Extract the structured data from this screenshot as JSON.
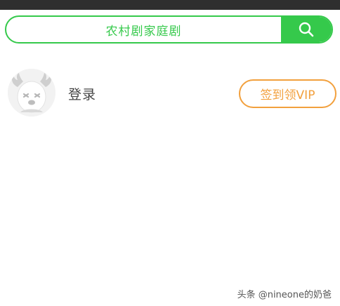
{
  "search": {
    "text": "农村剧家庭剧",
    "button_icon": "search-icon",
    "accent_color": "#35c94b"
  },
  "profile": {
    "avatar_icon": "moose-avatar-icon",
    "login_label": "登录",
    "vip_button_label": "签到领VIP",
    "vip_color": "#f2a03d"
  },
  "watermark": {
    "text": "头条 @nineone的奶爸"
  }
}
